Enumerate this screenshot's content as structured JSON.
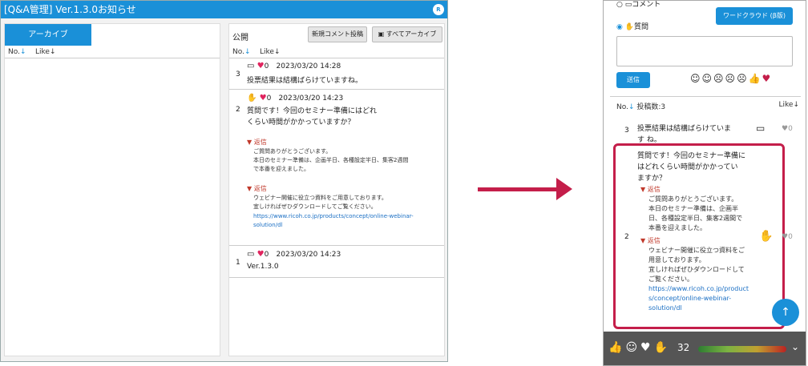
{
  "window": {
    "title": "[Q&A管理] Ver.1.3.0お知らせ",
    "badge": "RICOH"
  },
  "left_panel": {
    "tab_label": "アーカイブ",
    "col_no": "No.",
    "col_like": "Like"
  },
  "right_panel": {
    "section_label": "公開",
    "btn_new_comment": "新規コメント投稿",
    "btn_archive_all": "すべてアーカイブ",
    "col_no": "No.",
    "col_like": "Like",
    "items": [
      {
        "no": "3",
        "likes": "0",
        "date": "2023/03/20 14:28",
        "text": "投票結果は結構ばらけていますね。"
      },
      {
        "no": "2",
        "likes": "0",
        "date": "2023/03/20 14:23",
        "text_line1": "質問です！今回のセミナー準備にはどれ",
        "text_line2": "くらい時間がかかっていますか？",
        "reply1_head": "▼ 返信",
        "reply1_l1": "ご質問ありがとうございます。",
        "reply1_l2": "本日のセミナー準備は、企画半日、各種設定半日、集客2週間",
        "reply1_l3": "で本番を迎えました。",
        "reply2_head": "▼ 返信",
        "reply2_l1": "ウェビナー開催に役立つ資料をご用意しております。",
        "reply2_l2": "宜しければぜひダウンロードしてご覧ください。",
        "reply2_link1": "https://www.ricoh.co.jp/products/concept/online-webinar-",
        "reply2_link2": "solution/dl"
      },
      {
        "no": "1",
        "likes": "0",
        "date": "2023/03/20 14:23",
        "text": "Ver.1.3.0"
      }
    ]
  },
  "phone": {
    "radio_comment": "コメント",
    "radio_question": "質問",
    "btn_wordcloud": "ワードクラウド (β版)",
    "btn_send": "送信",
    "list_header_no": "No.",
    "list_header_count": "投稿数:3",
    "list_header_like": "Like",
    "item3_no": "3",
    "item3_l1": "投票結果は結構ばらけていま",
    "item3_l2": "す ね。",
    "item3_likes": "0",
    "item2_no": "2",
    "item2_l1": "質問です！今回のセミナー準備に",
    "item2_l2": "はどれくらい時間がかかってい",
    "item2_l3": "ますか？",
    "item2_r1_head": "▼ 返信",
    "item2_r1_l1": "ご質問ありがとうございます。",
    "item2_r1_l2": "本日のセミナー準備は、企画半",
    "item2_r1_l3": "日、各種設定半日、集客2週間で",
    "item2_r1_l4": "本番を迎えました。",
    "item2_r2_head": "▼ 返信",
    "item2_r2_l1": "ウェビナー開催に役立つ資料をご",
    "item2_r2_l2": "用意しております。",
    "item2_r2_l3": "宜しければぜひダウンロードして",
    "item2_r2_l4": "ご覧ください。",
    "item2_link1": "https://www.ricoh.co.jp/product",
    "item2_link2": "s/concept/online-webinar-",
    "item2_link3": "solution/dl",
    "item2_likes": "0",
    "reaction_count": "32"
  },
  "colors": {
    "accent": "#1a90d8",
    "highlight": "#c41e4a",
    "heart": "#e0245e"
  }
}
